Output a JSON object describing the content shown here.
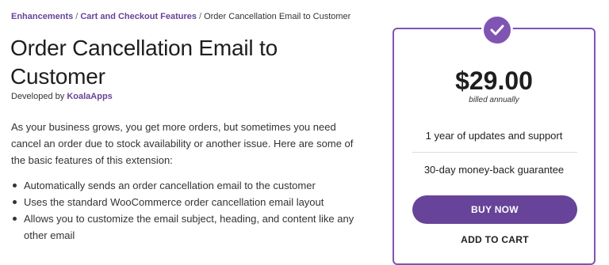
{
  "breadcrumb": {
    "items": [
      "Enhancements",
      "Cart and Checkout Features"
    ],
    "separator": "/",
    "current": "Order Cancellation Email to Customer"
  },
  "product": {
    "title": "Order Cancellation Email to Customer",
    "developed_by_label": "Developed by",
    "developer": "KoalaApps",
    "description": "As your business grows, you get more orders, but sometimes you need cancel an order due to stock availability or another issue. Here are some of the basic features of this extension:",
    "features": [
      "Automatically sends an order cancellation email to the customer",
      "Uses the standard WooCommerce order cancellation email layout",
      "Allows you to customize the email subject, heading, and content like any other email"
    ]
  },
  "pricing": {
    "badge_icon": "check-icon",
    "price": "$29.00",
    "billing": "billed annually",
    "feature_1": "1 year of updates and support",
    "feature_2": "30-day money-back guarantee",
    "buy_label": "BUY NOW",
    "add_label": "ADD TO CART"
  },
  "colors": {
    "accent": "#7f54b3",
    "button": "#674399",
    "link": "#674399"
  }
}
